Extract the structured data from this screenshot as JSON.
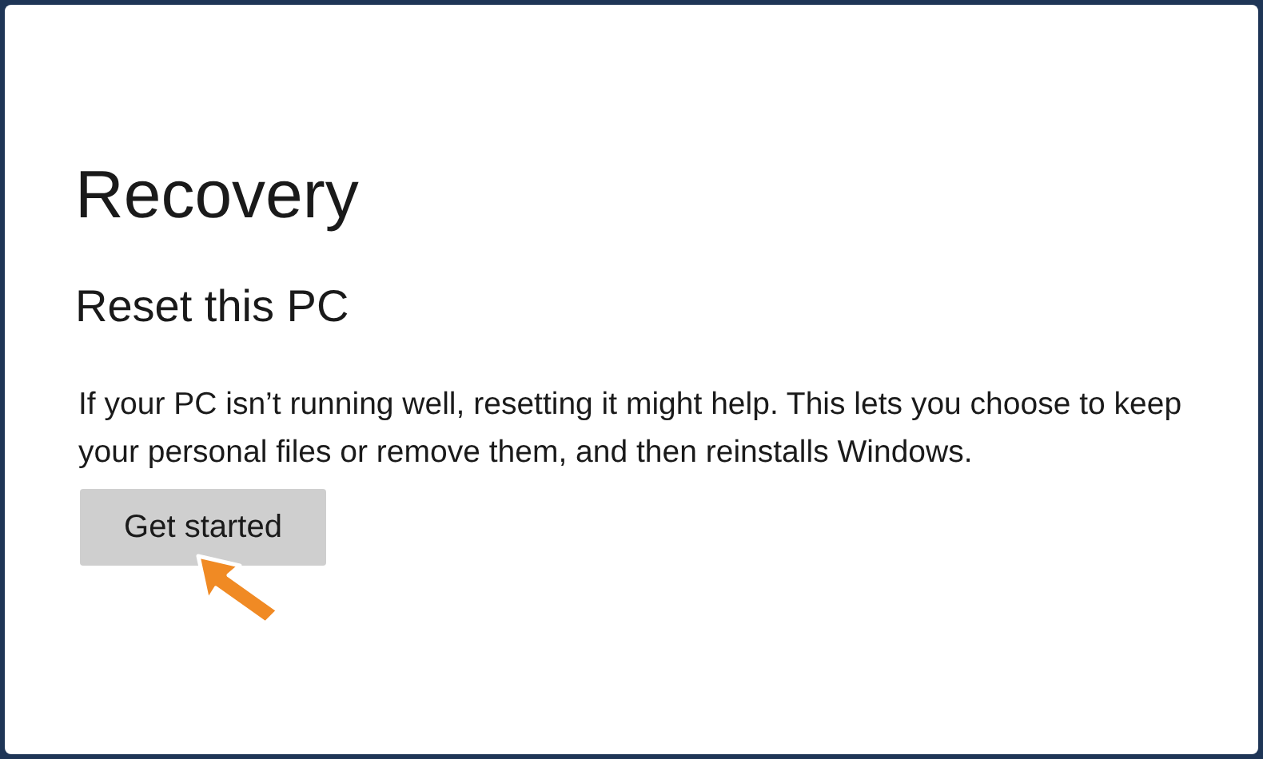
{
  "page": {
    "title": "Recovery"
  },
  "section": {
    "title": "Reset this PC",
    "description": "If your PC isn’t running well, resetting it might help. This lets you choose to keep your personal files or remove them, and then reinstalls Windows.",
    "button": "Get started"
  }
}
